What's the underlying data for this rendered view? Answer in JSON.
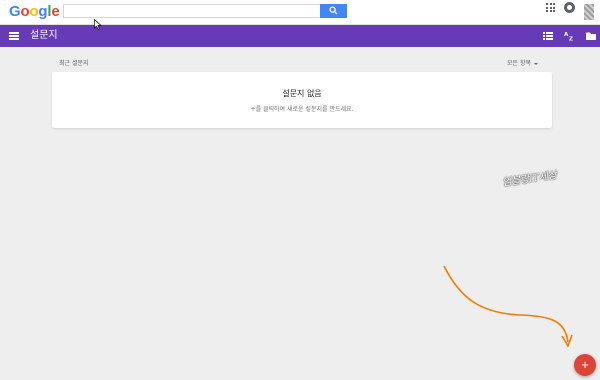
{
  "google": {
    "logo_letters": [
      "G",
      "o",
      "o",
      "g",
      "l",
      "e"
    ],
    "logo_colors": [
      "#4285f4",
      "#ea4335",
      "#fbbc05",
      "#4285f4",
      "#34a853",
      "#ea4335"
    ],
    "search_placeholder": "",
    "search_icon": "search-icon",
    "apps_icon": "apps-grid-icon",
    "notifications_icon": "notifications-icon"
  },
  "appbar": {
    "title": "설문지",
    "color": "#673ab7",
    "menu_icon": "menu-icon",
    "list_view_icon": "list-view-icon",
    "sort_icon": "sort-az-icon",
    "folder_icon": "folder-icon"
  },
  "section": {
    "title": "최근 설문지",
    "owner_filter": "모든 항목"
  },
  "empty_state": {
    "title": "설문지 없음",
    "description": "+를 클릭하여 새로운 설문지를 만드세요."
  },
  "watermark": "엄블랑IT세상",
  "fab": {
    "label": "+",
    "color": "#db4437"
  },
  "annotation_color": "#f57c00"
}
